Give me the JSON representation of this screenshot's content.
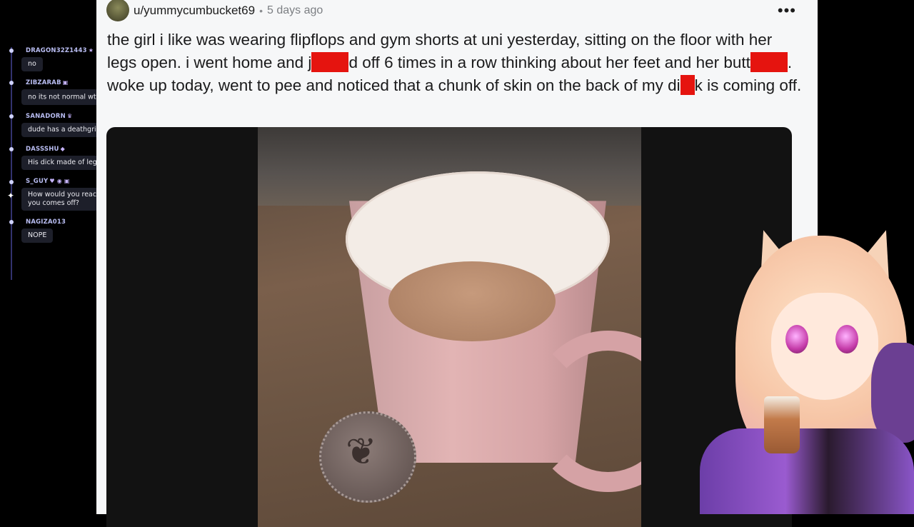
{
  "chat": {
    "messages": [
      {
        "user": "DRAGON32Z1443",
        "badge": "★",
        "text": "no"
      },
      {
        "user": "ZIBZARAB",
        "badge": "▣",
        "text": "no its not normal wtf",
        "emote": true
      },
      {
        "user": "SANADORN",
        "badge": "♛",
        "text": "dude has a deathgrip on it"
      },
      {
        "user": "DASSSHU",
        "badge": "◆",
        "text": "His dick made of lego"
      },
      {
        "user": "S_GUY",
        "badge": "♥ ◉ ▣",
        "text": "How would you react if a piece of you comes off?"
      },
      {
        "user": "NAGIZA013",
        "badge": "",
        "text": "NOPE"
      }
    ]
  },
  "post": {
    "username": "u/yummycumbucket69",
    "separator": "•",
    "time": "5 days ago",
    "more_label": "•••",
    "text_parts": {
      "p1": "the girl i like was wearing flipflops and gym shorts at uni yesterday, sitting on the floor with her legs open. i went home and j",
      "p2": "d off 6 times in a row thinking about her feet and her butt",
      "p3": ". woke up today, went to pee and noticed that a chunk of skin on the back of my di",
      "p4": "k is coming off."
    },
    "censor_color": "#e5140f"
  },
  "colors": {
    "card_background": "#f6f7f8",
    "chat_bubble": "#1d1f2a",
    "chat_username": "#b9bdf2"
  }
}
